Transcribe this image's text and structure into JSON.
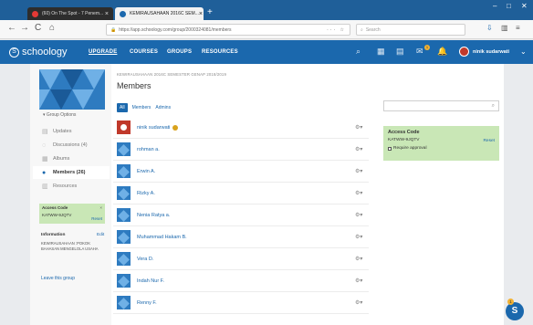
{
  "browser": {
    "tabs": [
      {
        "title": "(60) On The Spot - 7 Penem...",
        "favicon_color": "#e53935"
      },
      {
        "title": "KEMIRAUSAHAAN 2016C SEM...",
        "favicon_color": "#1b68ad"
      }
    ],
    "new_tab": "+",
    "url": "https://app.schoology.com/group/2000324081/members",
    "search_placeholder": "Search",
    "nav": {
      "back": "←",
      "forward": "→",
      "reload": "C",
      "home": "⌂"
    },
    "window_controls": {
      "minimize": "–",
      "maximize": "□",
      "close": "✕"
    }
  },
  "header": {
    "logo": "schoology",
    "logo_mark": "S",
    "nav": [
      "UPGRADE",
      "COURSES",
      "GROUPS",
      "RESOURCES"
    ],
    "notification_count": "1",
    "user_name": "ninik sudarwati",
    "caret": "⌄"
  },
  "sidebar": {
    "group_options": "▾ Group Options",
    "items": [
      {
        "label": "Updates",
        "icon": "updates-icon",
        "glyph": "▤"
      },
      {
        "label": "Discussions (4)",
        "icon": "discussions-icon",
        "glyph": "◌"
      },
      {
        "label": "Albums",
        "icon": "albums-icon",
        "glyph": "▦"
      },
      {
        "label": "Members (26)",
        "icon": "members-icon",
        "glyph": "●"
      },
      {
        "label": "Resources",
        "icon": "resources-icon",
        "glyph": "▥"
      }
    ],
    "access_code": {
      "title": "Access Code",
      "code": "KATWW-9JQTV",
      "reset": "Reset",
      "close": "×"
    },
    "information": {
      "title": "Information",
      "edit": "Edit",
      "text": "KEWIRAUSAHAAN :POKOK BAHASAN MENGELOLA USAHA"
    },
    "leave": "Leave this group"
  },
  "main": {
    "breadcrumb": "KEWIRAUSAHAAN 2016C SEMESTER GENAP 2018/2019",
    "title": "Members",
    "tabs": [
      "All",
      "Members",
      "Admins"
    ],
    "search_icon": "⌕",
    "members": [
      {
        "name": "ninik sudarwati",
        "admin": true,
        "avatar": "red"
      },
      {
        "name": "rohman a.",
        "admin": false,
        "avatar": "blue"
      },
      {
        "name": "Erwin A.",
        "admin": false,
        "avatar": "blue"
      },
      {
        "name": "Rizky A.",
        "admin": false,
        "avatar": "blue"
      },
      {
        "name": "Nenia Ratya a.",
        "admin": false,
        "avatar": "blue"
      },
      {
        "name": "Muhammad Hakam B.",
        "admin": false,
        "avatar": "blue"
      },
      {
        "name": "Vera D.",
        "admin": false,
        "avatar": "blue"
      },
      {
        "name": "Indah Nur F.",
        "admin": false,
        "avatar": "blue"
      },
      {
        "name": "Renny F.",
        "admin": false,
        "avatar": "blue"
      }
    ],
    "gear_glyph": "⚙▾",
    "access_code": {
      "title": "Access Code",
      "code": "KATWW-9JQTV",
      "reset": "Reset",
      "require": "Require approval"
    }
  },
  "chat": {
    "label": "S",
    "badge": "1"
  },
  "colors": {
    "brand": "#1b68ad",
    "access_green": "#c9e7b6",
    "admin_badge": "#d9a21c"
  }
}
